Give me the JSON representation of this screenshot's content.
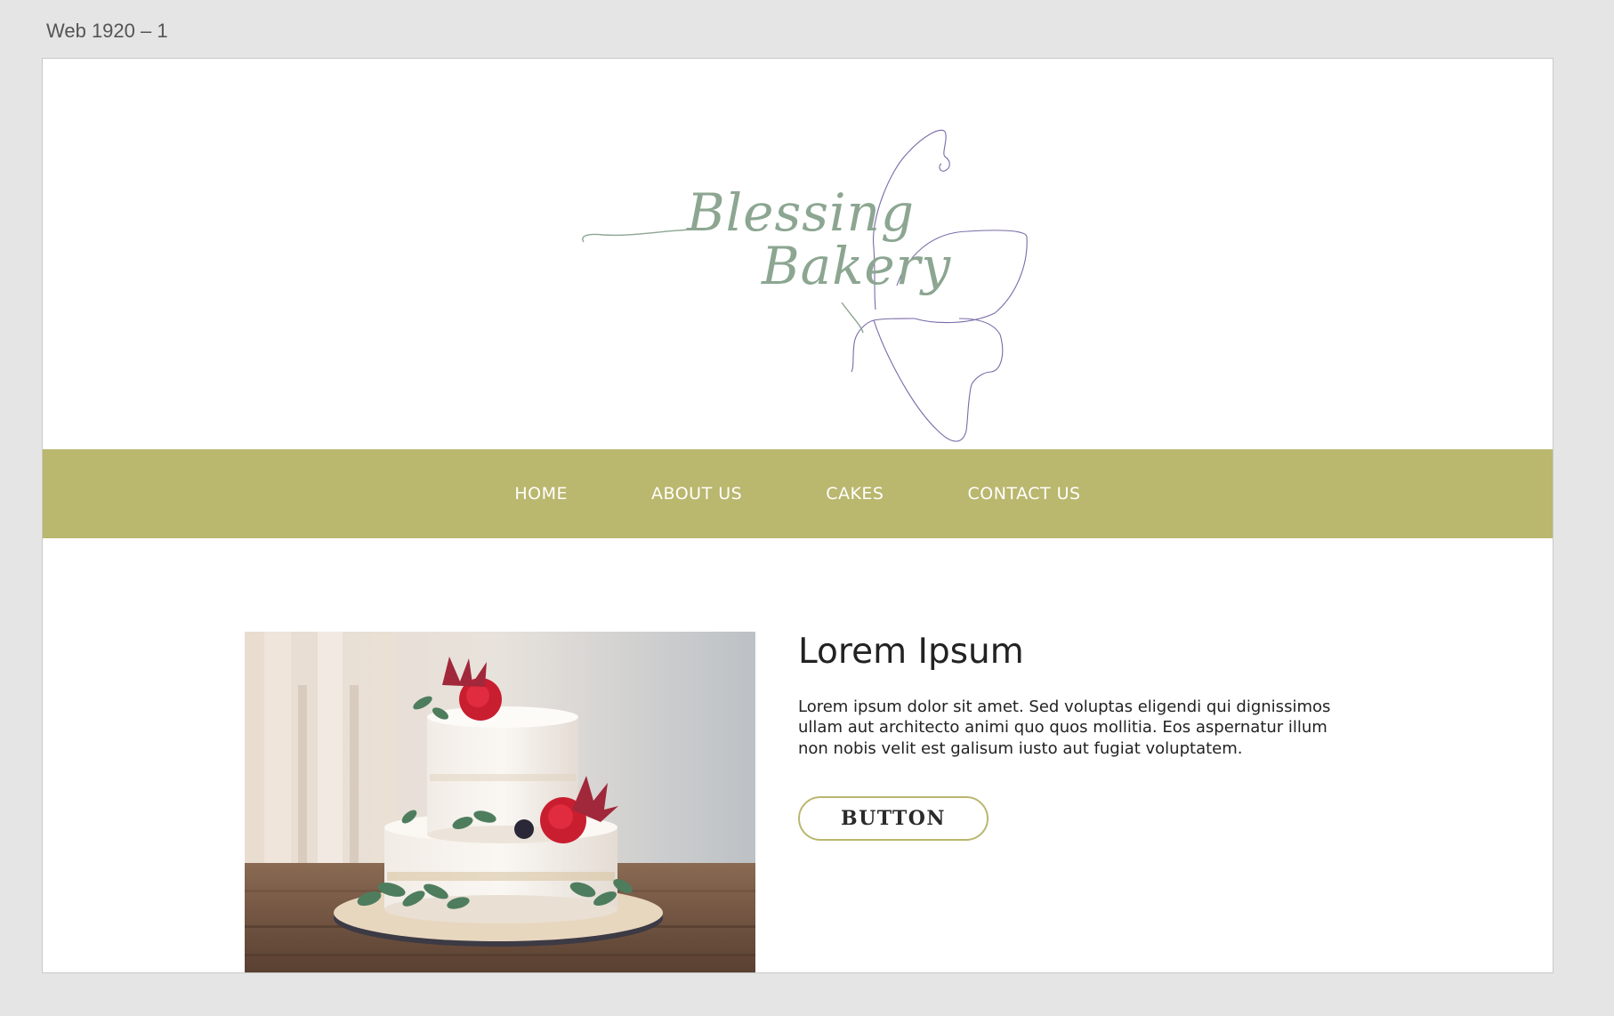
{
  "artboard": {
    "label": "Web 1920 – 1"
  },
  "logo": {
    "line1": "Blessing",
    "line2": "Bakery",
    "text_color": "#8ca691",
    "outline_color": "#7a6aa8"
  },
  "nav": {
    "background": "#bab76e",
    "items": [
      {
        "label": "Home"
      },
      {
        "label": "About us"
      },
      {
        "label": "Cakes"
      },
      {
        "label": "Contact us"
      }
    ]
  },
  "hero": {
    "image_alt": "cake-photo",
    "heading": "Lorem Ipsum",
    "body": "Lorem ipsum dolor sit amet. Sed voluptas eligendi qui dignissimos ullam aut architecto animi quo quos mollitia. Eos aspernatur illum non nobis velit est galisum iusto aut fugiat voluptatem.",
    "button_label": "BUTTON",
    "button_border_color": "#bab76e"
  }
}
